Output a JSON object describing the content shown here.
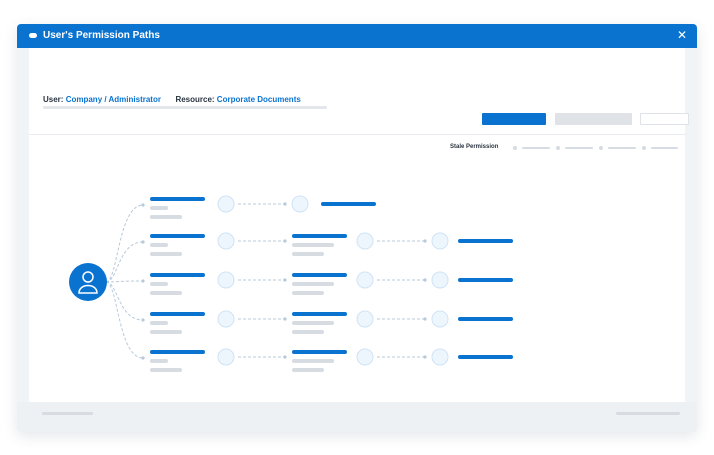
{
  "window": {
    "title": "User's Permission Paths",
    "close_icon": "close-icon"
  },
  "header": {
    "user_label": "User:",
    "user_value": "Company / Administrator",
    "resource_label": "Resource:",
    "resource_value": "Corporate Documents"
  },
  "legend": {
    "label": "Stale Permission"
  },
  "colors": {
    "accent": "#0a73d0",
    "node_fill": "#eef6fd",
    "node_stroke": "#cfe3f6",
    "placeholder": "#d7dce2"
  },
  "graph": {
    "root_icon": "user-icon",
    "branch_count": 5
  }
}
